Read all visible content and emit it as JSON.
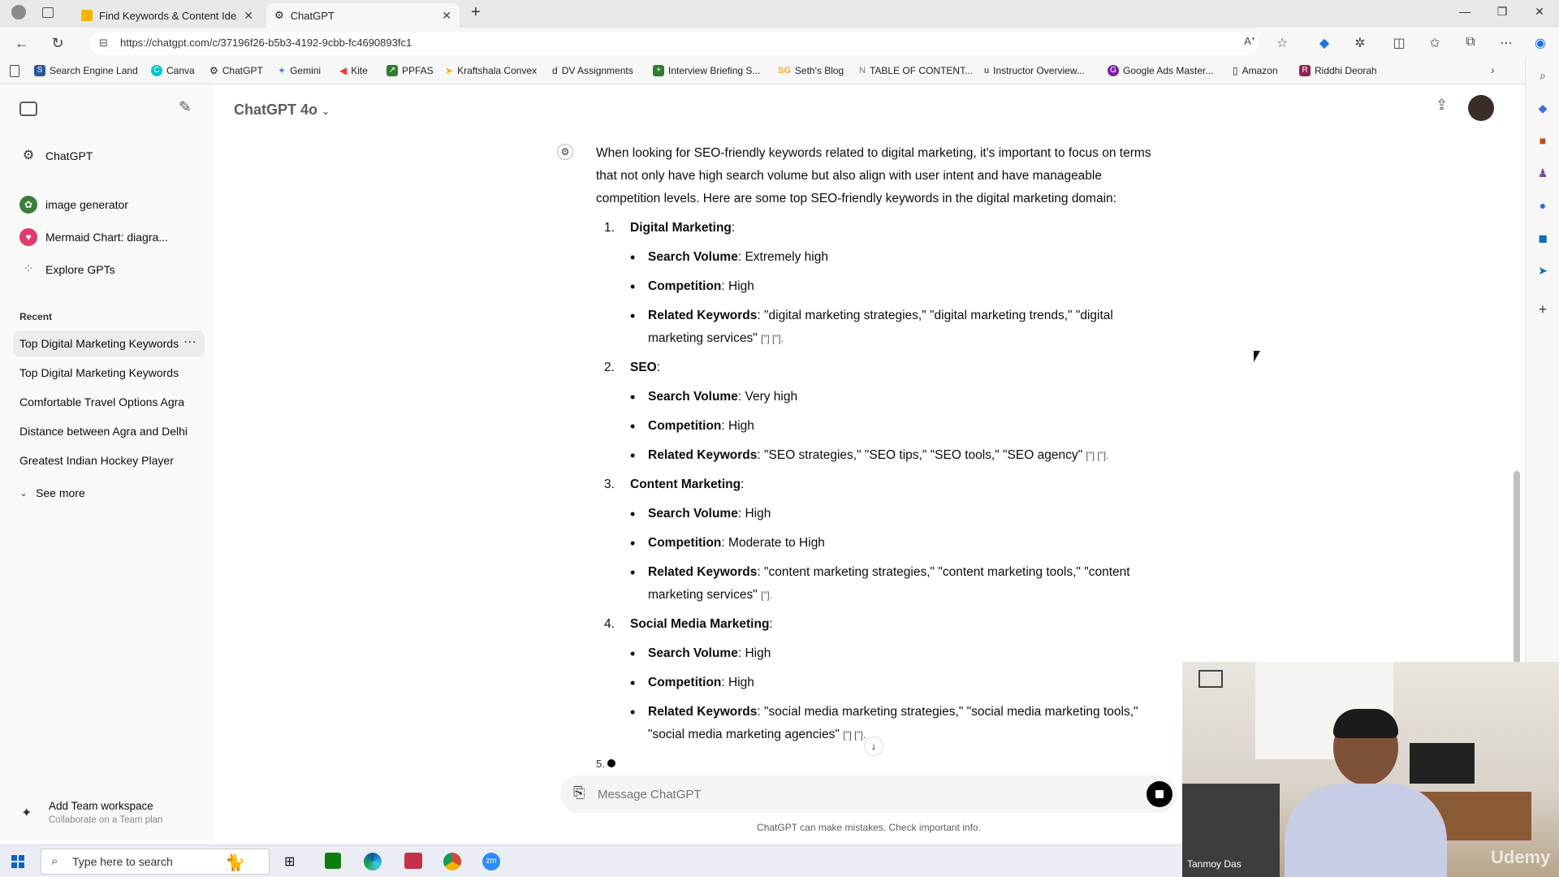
{
  "browser": {
    "tabs": [
      {
        "title": "Find Keywords & Content Ideas"
      },
      {
        "title": "ChatGPT"
      }
    ],
    "url": "https://chatgpt.com/c/37196f26-b5b3-4192-9cbb-fc4690893fc1",
    "bookmarks": [
      {
        "label": "Search Engine Land",
        "color": "#2b579a"
      },
      {
        "label": "Canva",
        "color": "#00c4cc"
      },
      {
        "label": "ChatGPT",
        "color": "#444"
      },
      {
        "label": "Gemini",
        "color": "#4285f4"
      },
      {
        "label": "Kite",
        "color": "#e53935"
      },
      {
        "label": "PPFAS",
        "color": "#2e7d32"
      },
      {
        "label": "Kraftshala Convex",
        "color": "#f9a825"
      },
      {
        "label": "DV Assignments",
        "color": "#333"
      },
      {
        "label": "Interview Briefing S...",
        "color": "#2e7d32"
      },
      {
        "label": "Seth's Blog",
        "color": "#f9a825"
      },
      {
        "label": "TABLE OF CONTENT...",
        "color": "#777"
      },
      {
        "label": "Instructor Overview...",
        "color": "#555"
      },
      {
        "label": "Google Ads Master...",
        "color": "#7b1fa2"
      },
      {
        "label": "Amazon",
        "color": "#555"
      },
      {
        "label": "Riddhi Deorah",
        "color": "#8e2450"
      }
    ]
  },
  "sidebar": {
    "top_items": [
      {
        "label": "ChatGPT",
        "icon": "chatgpt-logo-icon"
      },
      {
        "label": "image generator",
        "icon": "gpt-avatar-icon"
      },
      {
        "label": "Mermaid Chart: diagra...",
        "icon": "mermaid-icon"
      },
      {
        "label": "Explore GPTs",
        "icon": "grid-icon"
      }
    ],
    "recent_heading": "Recent",
    "recent": [
      "Top Digital Marketing Keywords",
      "Top Digital Marketing Keywords",
      "Comfortable Travel Options Agra",
      "Distance between Agra and Delhi",
      "Greatest Indian Hockey Player"
    ],
    "see_more": "See more",
    "team": {
      "title": "Add Team workspace",
      "subtitle": "Collaborate on a Team plan"
    }
  },
  "main": {
    "model": "ChatGPT 4o",
    "intro": "When looking for SEO-friendly keywords related to digital marketing, it's important to focus on terms that not only have high search volume but also align with user intent and have manageable competition levels. Here are some top SEO-friendly keywords in the digital marketing domain:",
    "items": [
      {
        "num": "1.",
        "title": "Digital Marketing",
        "volume": "Extremely high",
        "competition": "High",
        "related": "\"digital marketing strategies,\" \"digital marketing trends,\" \"digital marketing services\"",
        "cites": "[”] [”]."
      },
      {
        "num": "2.",
        "title": "SEO",
        "volume": "Very high",
        "competition": "High",
        "related": "\"SEO strategies,\" \"SEO tips,\" \"SEO tools,\" \"SEO agency\"",
        "cites": "[”] [”]."
      },
      {
        "num": "3.",
        "title": "Content Marketing",
        "volume": "High",
        "competition": "Moderate to High",
        "related": "\"content marketing strategies,\" \"content marketing tools,\" \"content marketing services\"",
        "cites": "[”]."
      },
      {
        "num": "4.",
        "title": "Social Media Marketing",
        "volume": "High",
        "competition": "High",
        "related": "\"social media marketing strategies,\" \"social media marketing tools,\" \"social media marketing agencies\"",
        "cites": "[”] [”]."
      }
    ],
    "labels": {
      "volume": "Search Volume",
      "competition": "Competition",
      "related": "Related Keywords"
    },
    "next_num": "5.",
    "composer_placeholder": "Message ChatGPT",
    "disclaimer": "ChatGPT can make mistakes. Check important info."
  },
  "webcam": {
    "name": "Tanmoy Das",
    "watermark": "Udemy"
  },
  "taskbar": {
    "search_placeholder": "Type here to search"
  }
}
